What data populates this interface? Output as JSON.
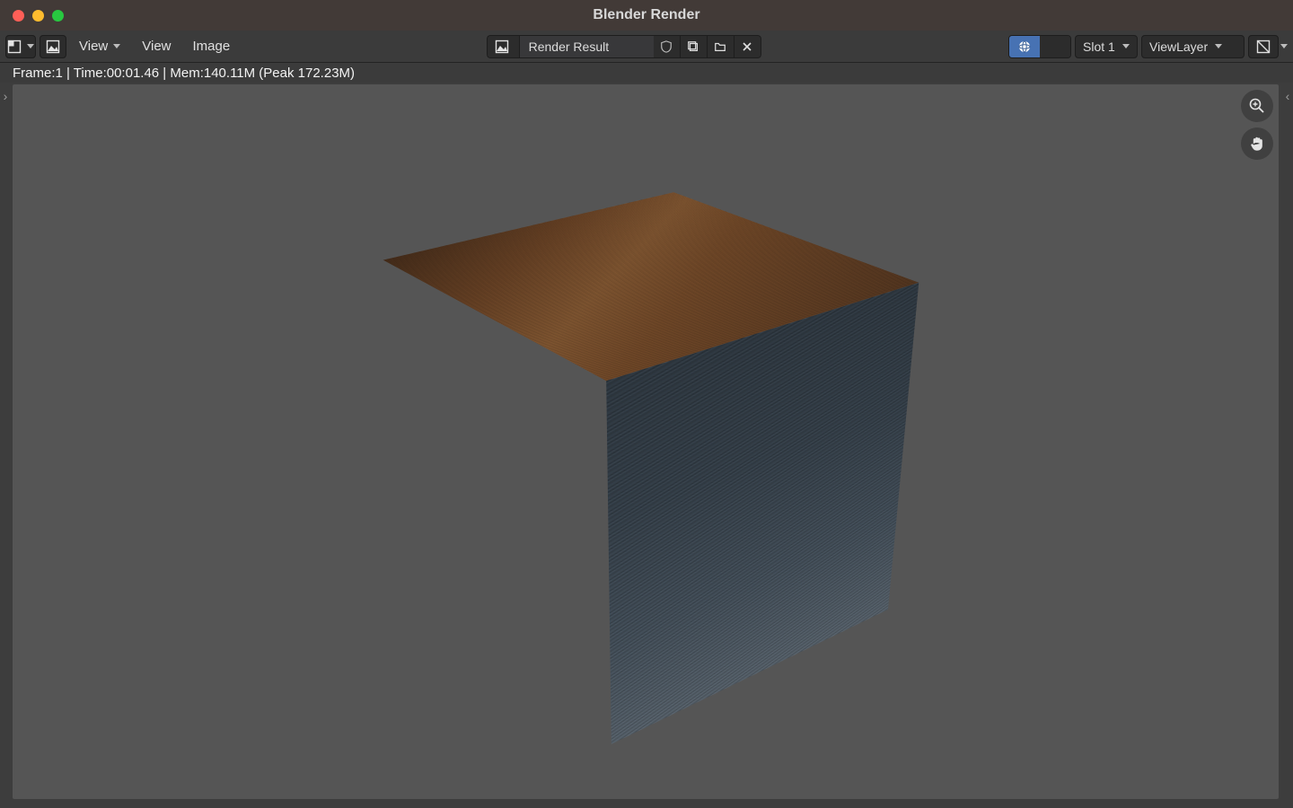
{
  "window": {
    "title": "Blender Render"
  },
  "header": {
    "view_menu": "View",
    "view_menu_2": "View",
    "image_menu": "Image",
    "image_name": "Render Result",
    "slot": "Slot 1",
    "view_layer": "ViewLayer"
  },
  "status": {
    "line": "Frame:1 | Time:00:01.46 | Mem:140.11M (Peak 172.23M)"
  }
}
